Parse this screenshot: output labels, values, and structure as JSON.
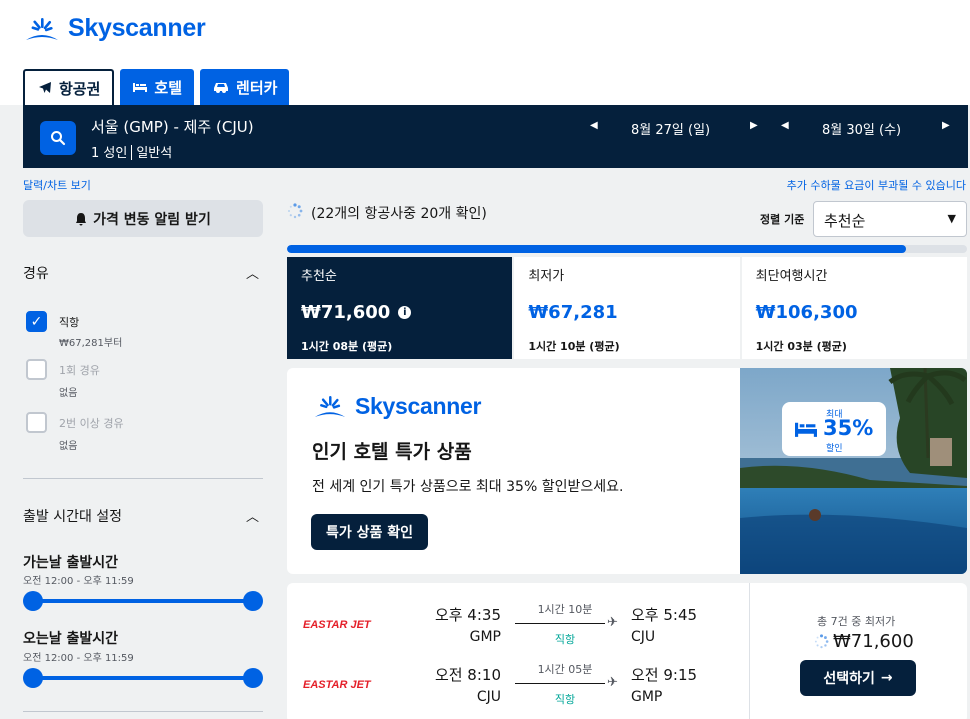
{
  "brand": {
    "name": "Skyscanner",
    "color": "#0062e3"
  },
  "tabs": [
    {
      "label": "항공권",
      "icon": "plane-icon",
      "active": true
    },
    {
      "label": "호텔",
      "icon": "bed-icon",
      "active": false
    },
    {
      "label": "렌터카",
      "icon": "car-icon",
      "active": false
    }
  ],
  "search": {
    "route": "서울 (GMP) - 제주 (CJU)",
    "passengers": "1 성인",
    "cabin": "일반석",
    "depart_date": "8월 27일 (일)",
    "return_date": "8월 30일 (수)"
  },
  "links": {
    "calendar": "달력/차트 보기",
    "fees_note": "추가 수하물 요금이 부과될 수 있습니다"
  },
  "price_alert_label": "가격 변동 알림 받기",
  "filters": {
    "stops": {
      "title": "경유",
      "options": [
        {
          "label": "직항",
          "sub": "₩67,281부터",
          "checked": true,
          "enabled": true
        },
        {
          "label": "1회 경유",
          "sub": "없음",
          "checked": false,
          "enabled": false
        },
        {
          "label": "2번 이상 경유",
          "sub": "없음",
          "checked": false,
          "enabled": false
        }
      ]
    },
    "departure_times": {
      "title": "출발 시간대 설정",
      "outbound": {
        "title": "가는날 출발시간",
        "range": "오전 12:00 - 오후 11:59"
      },
      "inbound": {
        "title": "오는날 출발시간",
        "range": "오전 12:00 - 오후 11:59"
      }
    }
  },
  "status": {
    "checking_text": "(22개의 항공사중 20개 확인)",
    "progress": 0.91
  },
  "sort": {
    "label": "정렬 기준",
    "selected": "추천순"
  },
  "sort_tabs": [
    {
      "name": "추천순",
      "price": "₩71,600",
      "duration": "1시간 08분 (평균)",
      "active": true
    },
    {
      "name": "최저가",
      "price": "₩67,281",
      "duration": "1시간 10분 (평균)",
      "active": false
    },
    {
      "name": "최단여행시간",
      "price": "₩106,300",
      "duration": "1시간 03분 (평균)",
      "active": false
    }
  ],
  "ad": {
    "title": "인기 호텔 특가 상품",
    "description": "전 세계 인기 특가 상품으로 최대 35% 할인받으세요.",
    "button": "특가 상품 확인",
    "badge_top": "최대",
    "badge_value": "35%",
    "badge_bottom": "할인"
  },
  "result": {
    "legs": [
      {
        "airline": "EASTAR JET",
        "dep_time": "오후 4:35",
        "dep_code": "GMP",
        "duration": "1시간 10분",
        "stops": "직항",
        "arr_time": "오후 5:45",
        "arr_code": "CJU"
      },
      {
        "airline": "EASTAR JET",
        "dep_time": "오전 8:10",
        "dep_code": "CJU",
        "duration": "1시간 05분",
        "stops": "직항",
        "arr_time": "오전 9:15",
        "arr_code": "GMP"
      }
    ],
    "deal_count": "총 7건 중 최저가",
    "price": "₩71,600",
    "select_label": "선택하기"
  }
}
